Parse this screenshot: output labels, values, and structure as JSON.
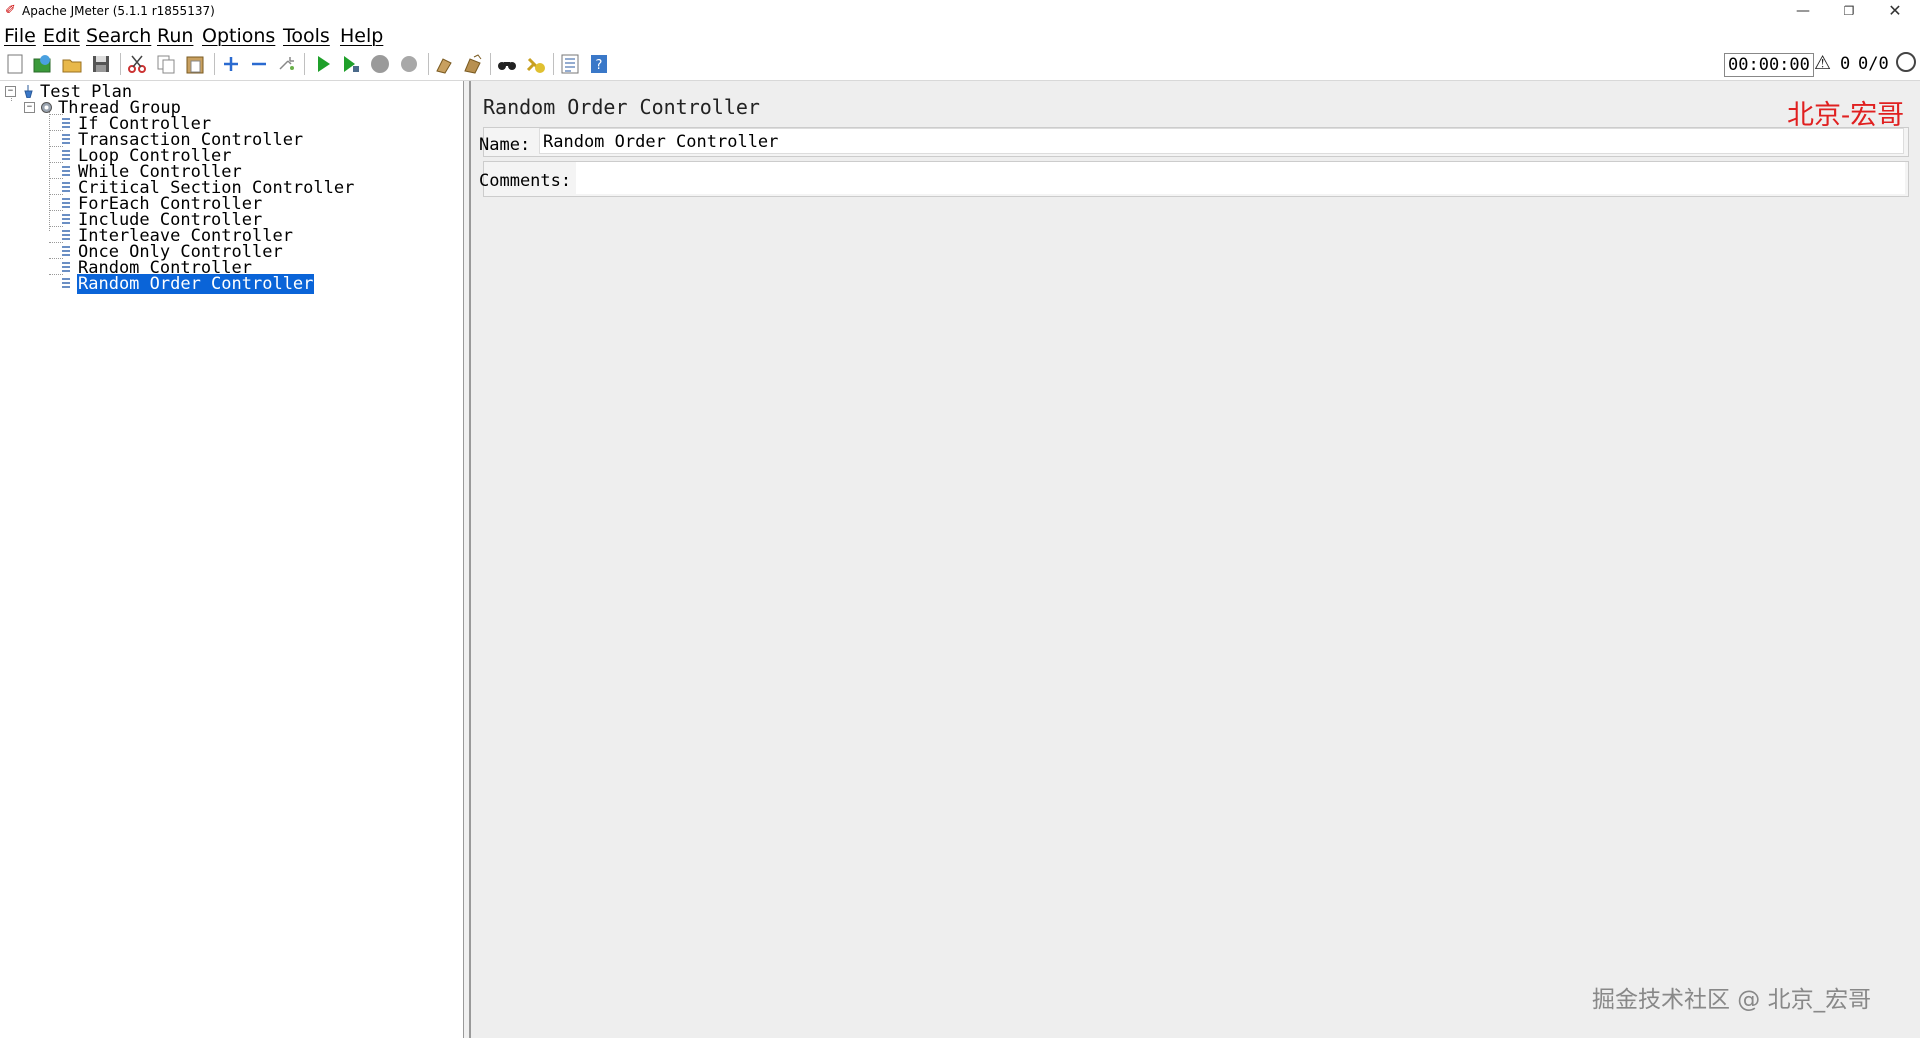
{
  "window": {
    "title": "Apache JMeter (5.1.1 r1855137)",
    "min": "—",
    "max": "❐",
    "close": "✕"
  },
  "menu": [
    "File",
    "Edit",
    "Search",
    "Run",
    "Options",
    "Tools",
    "Help"
  ],
  "toolbar": {
    "buttons": [
      "new-icon",
      "templates-icon",
      "open-icon",
      "save-icon",
      "cut-icon",
      "copy-icon",
      "paste-icon",
      "expand-icon",
      "collapse-icon",
      "toggle-icon",
      "start-icon",
      "start-no-pauses-icon",
      "stop-icon",
      "shutdown-icon",
      "clear-icon",
      "clear-all-icon",
      "search-icon",
      "reset-search-icon",
      "function-helper-icon",
      "help-icon"
    ],
    "timer": "00:00:00",
    "warnings": "0",
    "threads": "0/0"
  },
  "tree": {
    "root": "Test Plan",
    "thread_group": "Thread Group",
    "controllers": [
      "If Controller",
      "Transaction Controller",
      "Loop Controller",
      "While Controller",
      "Critical Section Controller",
      "ForEach Controller",
      "Include Controller",
      "Interleave Controller",
      "Once Only Controller",
      "Random Controller",
      "Random Order Controller"
    ],
    "selected": "Random Order Controller"
  },
  "panel": {
    "title": "Random Order Controller",
    "name_label": "Name:",
    "name_value": "Random Order Controller",
    "comments_label": "Comments:",
    "comments_value": ""
  },
  "watermarks": {
    "top": "北京-宏哥",
    "bottom": "掘金技术社区 @ 北京_宏哥"
  }
}
